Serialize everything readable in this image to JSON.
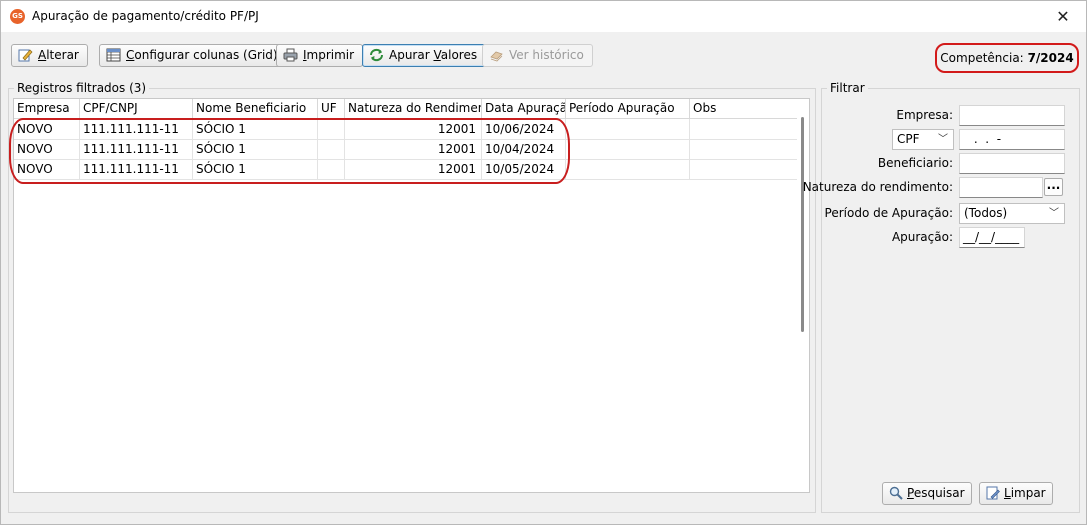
{
  "window": {
    "title": "Apuração de pagamento/crédito PF/PJ",
    "app_icon_text": "GS"
  },
  "toolbar": {
    "alterar": {
      "label": "Alterar",
      "mnemonic": "A",
      "rest": "lterar"
    },
    "configurar": {
      "label": "Configurar colunas (Grid)",
      "mnemonic": "C",
      "rest": "onfigurar colunas (Grid)"
    },
    "imprimir": {
      "label": "Imprimir",
      "mnemonic": "I",
      "rest": "mprimir"
    },
    "apurar": {
      "label": "Apurar Valores",
      "pre": "Apurar ",
      "mnemonic": "V",
      "rest": "alores"
    },
    "historico": {
      "label": "Ver histórico"
    }
  },
  "competencia": {
    "label": "Competência:",
    "value": "7/2024"
  },
  "grid": {
    "group_label": "Registros filtrados (3)",
    "columns": [
      "Empresa",
      "CPF/CNPJ",
      "Nome Beneficiario",
      "UF",
      "Natureza do Rendimento",
      "Data Apuração",
      "Período Apuração",
      "Obs"
    ],
    "rows": [
      [
        "NOVO",
        "111.111.111-11",
        "SÓCIO 1",
        "",
        "12001",
        "10/06/2024",
        "",
        ""
      ],
      [
        "NOVO",
        "111.111.111-11",
        "SÓCIO 1",
        "",
        "12001",
        "10/04/2024",
        "",
        ""
      ],
      [
        "NOVO",
        "111.111.111-11",
        "SÓCIO 1",
        "",
        "12001",
        "10/05/2024",
        "",
        ""
      ]
    ]
  },
  "filter": {
    "group_label": "Filtrar",
    "empresa_label": "Empresa:",
    "empresa_value": "",
    "doc_type": "CPF",
    "doc_mask": " .  .  -",
    "beneficiario_label": "Beneficiario:",
    "beneficiario_value": "",
    "natureza_label": "Natureza do rendimento:",
    "natureza_value": "",
    "natureza_button": "...",
    "periodo_label": "Período de Apuração:",
    "periodo_value": "(Todos)",
    "apuracao_label": "Apuração:",
    "apuracao_mask": "__/__/____",
    "pesquisar": {
      "label": "Pesquisar",
      "mnemonic": "P",
      "rest": "esquisar"
    },
    "limpar": {
      "label": "Limpar",
      "mnemonic": "L",
      "rest": "impar"
    }
  },
  "colors": {
    "highlight": "#d21a1a",
    "accent": "#3c7fb1",
    "app_icon": "#e8632b"
  }
}
